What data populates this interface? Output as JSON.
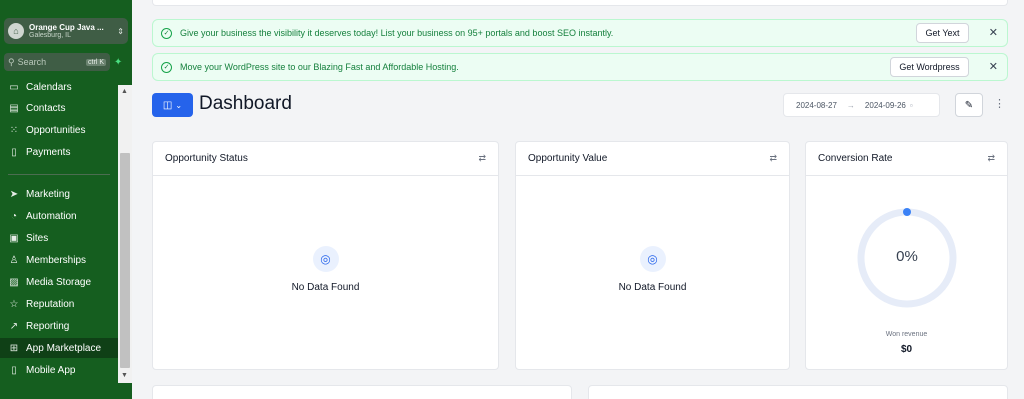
{
  "sidebar": {
    "location_name": "Orange Cup Java ...",
    "location_sub": "Galesburg, IL",
    "search_placeholder": "Search",
    "search_shortcut": "ctrl K",
    "items": [
      {
        "label": "Calendars",
        "icon": "calendar-icon"
      },
      {
        "label": "Contacts",
        "icon": "contacts-icon"
      },
      {
        "label": "Opportunities",
        "icon": "opportunities-icon"
      },
      {
        "label": "Payments",
        "icon": "payments-icon"
      },
      {
        "label": "Marketing",
        "icon": "send-icon"
      },
      {
        "label": "Automation",
        "icon": "automation-icon"
      },
      {
        "label": "Sites",
        "icon": "sites-icon"
      },
      {
        "label": "Memberships",
        "icon": "memberships-icon"
      },
      {
        "label": "Media Storage",
        "icon": "media-icon"
      },
      {
        "label": "Reputation",
        "icon": "star-icon"
      },
      {
        "label": "Reporting",
        "icon": "trend-icon"
      },
      {
        "label": "App Marketplace",
        "icon": "grid-icon"
      },
      {
        "label": "Mobile App",
        "icon": "mobile-icon"
      }
    ],
    "active_item": "App Marketplace",
    "colors": {
      "background": "#155e1f",
      "active": "#0f4016"
    }
  },
  "banners": [
    {
      "text": "Give your business the visibility it deserves today! List your business on 95+ portals and boost SEO instantly.",
      "button": "Get Yext"
    },
    {
      "text": "Move your WordPress site to our Blazing Fast and Affordable Hosting.",
      "button": "Get Wordpress"
    }
  ],
  "header": {
    "title": "Dashboard",
    "date_start": "2024-08-27",
    "date_end": "2024-09-26"
  },
  "cards": [
    {
      "title": "Opportunity Status",
      "empty_text": "No Data Found"
    },
    {
      "title": "Opportunity Value",
      "empty_text": "No Data Found"
    },
    {
      "title": "Conversion Rate",
      "percent": "0%",
      "caption": "Won revenue",
      "value": "$0"
    }
  ],
  "accent_color": "#2563eb"
}
